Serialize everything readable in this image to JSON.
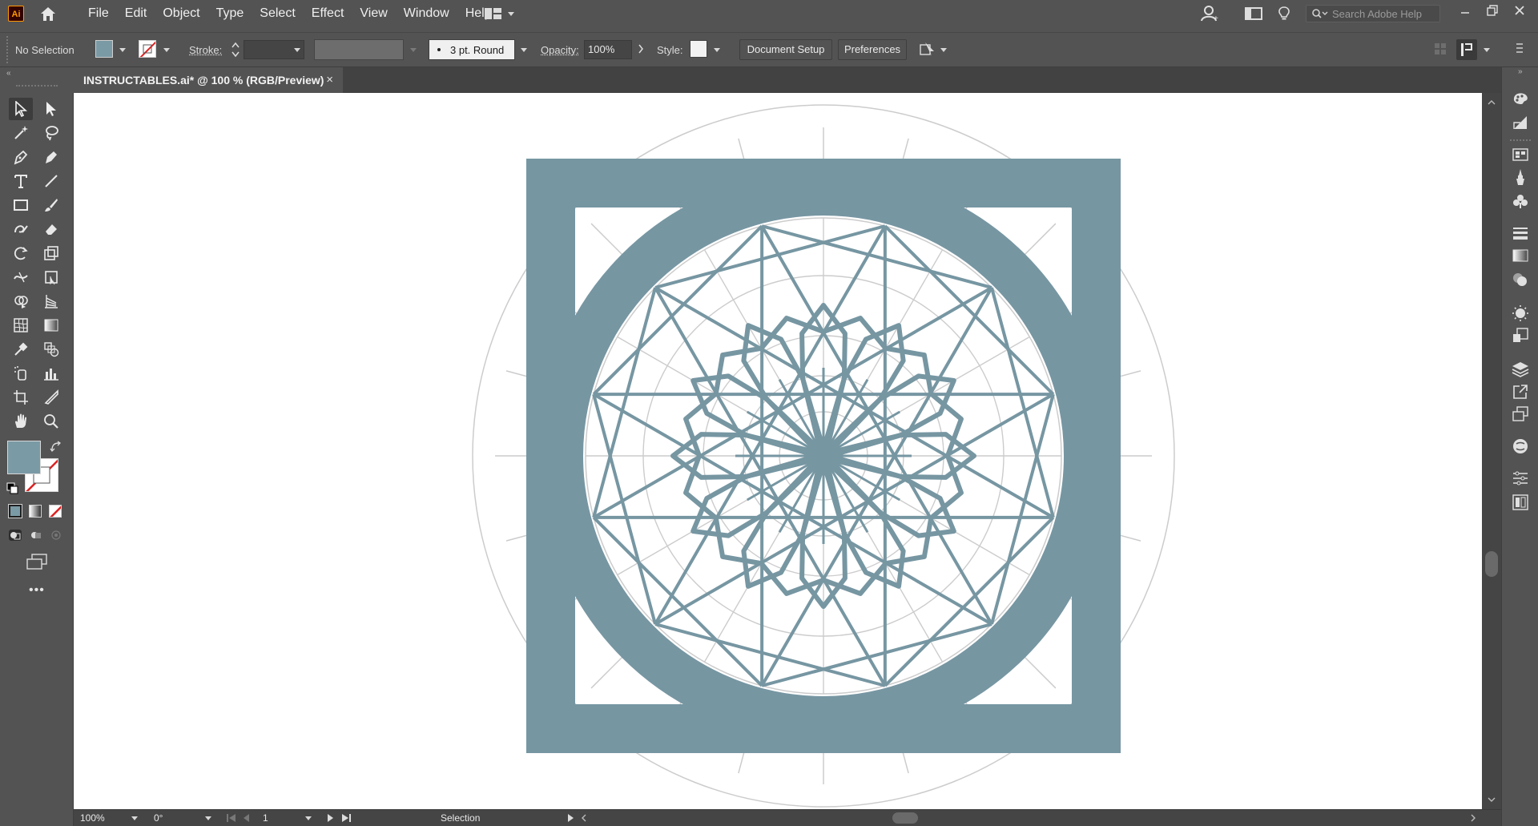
{
  "app": {
    "logo_text": "Ai"
  },
  "menu": {
    "items": [
      "File",
      "Edit",
      "Object",
      "Type",
      "Select",
      "Effect",
      "View",
      "Window",
      "Help"
    ]
  },
  "search": {
    "placeholder": "Search Adobe Help"
  },
  "control_bar": {
    "selection_status": "No Selection",
    "stroke_label": "Stroke:",
    "brush_value": "3 pt. Round",
    "opacity_label": "Opacity:",
    "opacity_value": "100%",
    "style_label": "Style:",
    "document_setup_label": "Document Setup",
    "preferences_label": "Preferences"
  },
  "document_tab": {
    "title": "INSTRUCTABLES.ai* @ 100 % (RGB/Preview)",
    "close": "×"
  },
  "status_bar": {
    "zoom": "100%",
    "rotation": "0°",
    "artboard_number": "1",
    "current_tool": "Selection"
  },
  "colors": {
    "fill": "#7a9aa5",
    "art_teal": "#7696a2",
    "guide_gray": "#cccccc",
    "ui_bg": "#535353"
  }
}
